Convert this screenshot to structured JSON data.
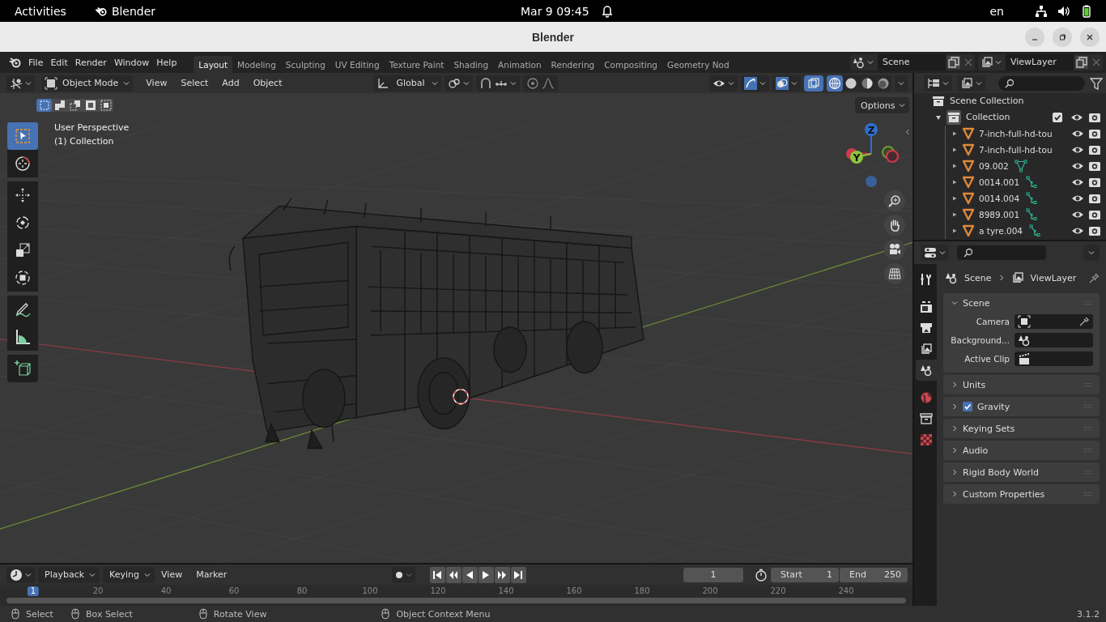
{
  "system_bar": {
    "activities": "Activities",
    "app": "Blender",
    "clock": "Mar 9  09:45",
    "language": "en"
  },
  "window": {
    "title": "Blender"
  },
  "menu": [
    "File",
    "Edit",
    "Render",
    "Window",
    "Help"
  ],
  "workspaces": [
    {
      "label": "Layout",
      "selected": true
    },
    {
      "label": "Modeling",
      "selected": false
    },
    {
      "label": "Sculpting",
      "selected": false
    },
    {
      "label": "UV Editing",
      "selected": false
    },
    {
      "label": "Texture Paint",
      "selected": false
    },
    {
      "label": "Shading",
      "selected": false
    },
    {
      "label": "Animation",
      "selected": false
    },
    {
      "label": "Rendering",
      "selected": false
    },
    {
      "label": "Compositing",
      "selected": false
    },
    {
      "label": "Geometry Nod",
      "selected": false
    }
  ],
  "scene": "Scene",
  "view_layer": "ViewLayer",
  "viewport": {
    "mode": "Object Mode",
    "menus": [
      "View",
      "Select",
      "Add",
      "Object"
    ],
    "orientation": "Global",
    "options": "Options",
    "overlay_lines": [
      "User Perspective",
      "(1) Collection"
    ],
    "select_modes": [
      {
        "kind": "new",
        "selected": true
      },
      {
        "kind": "extend",
        "selected": false
      },
      {
        "kind": "subtract",
        "selected": false
      },
      {
        "kind": "invert",
        "selected": false
      },
      {
        "kind": "intersect",
        "selected": false
      }
    ],
    "tools": [
      {
        "kind": "select",
        "selected": true
      },
      {
        "kind": "cursor",
        "selected": false
      },
      {
        "kind": "move",
        "selected": false
      },
      {
        "kind": "rotate",
        "selected": false
      },
      {
        "kind": "scale",
        "selected": false
      },
      {
        "kind": "transform",
        "selected": false
      },
      {
        "kind": "annotate",
        "selected": false
      },
      {
        "kind": "measure",
        "selected": false
      },
      {
        "kind": "add-cube",
        "selected": false
      }
    ],
    "shading": [
      {
        "kind": "wireframe",
        "selected": true
      },
      {
        "kind": "solid",
        "selected": false
      },
      {
        "kind": "material",
        "selected": false
      },
      {
        "kind": "rendered",
        "selected": false
      }
    ],
    "gizmo": {
      "z": "Z",
      "y": "Y"
    }
  },
  "timeline": {
    "menus": [
      "Playback",
      "Keying",
      "View",
      "Marker"
    ],
    "current_frame": "1",
    "start_label": "Start",
    "start": "1",
    "end_label": "End",
    "end": "250",
    "ruler": [
      {
        "label": "1",
        "selected": true
      },
      {
        "label": "20",
        "selected": false
      },
      {
        "label": "40",
        "selected": false
      },
      {
        "label": "60",
        "selected": false
      },
      {
        "label": "80",
        "selected": false
      },
      {
        "label": "100",
        "selected": false
      },
      {
        "label": "120",
        "selected": false
      },
      {
        "label": "140",
        "selected": false
      },
      {
        "label": "160",
        "selected": false
      },
      {
        "label": "180",
        "selected": false
      },
      {
        "label": "200",
        "selected": false
      },
      {
        "label": "220",
        "selected": false
      },
      {
        "label": "240",
        "selected": false
      }
    ]
  },
  "outliner": {
    "root": "Scene Collection",
    "collection": {
      "name": "Collection",
      "checked": true,
      "expanded": true,
      "children": [
        {
          "name": "7-inch-full-hd-tou"
        },
        {
          "name": "7-inch-full-hd-tou"
        },
        {
          "name": "09.002",
          "kind": "vertices"
        },
        {
          "name": "0014.001",
          "kind": "hook"
        },
        {
          "name": "0014.004",
          "kind": "hook"
        },
        {
          "name": "8989.001",
          "kind": "hook"
        },
        {
          "name": "a tyre.004",
          "kind": "hook"
        }
      ]
    }
  },
  "properties": {
    "tabs": [
      {
        "kind": "tool",
        "selected": false
      },
      {
        "kind": "render",
        "selected": false
      },
      {
        "kind": "output",
        "selected": false
      },
      {
        "kind": "view-layer",
        "selected": false
      },
      {
        "kind": "scene",
        "selected": true
      },
      {
        "kind": "world",
        "selected": false
      },
      {
        "kind": "collection",
        "selected": false
      },
      {
        "kind": "texture",
        "selected": false
      }
    ],
    "breadcrumb": [
      "Scene",
      "ViewLayer"
    ],
    "panels": [
      {
        "title": "Scene",
        "expanded": true,
        "fields": [
          {
            "label": "Camera",
            "kind": "camera"
          },
          {
            "label": "Background...",
            "kind": "scene"
          },
          {
            "label": "Active Clip",
            "kind": "clip"
          }
        ]
      },
      {
        "title": "Units",
        "expanded": false
      },
      {
        "title": "Gravity",
        "expanded": false,
        "checked": true
      },
      {
        "title": "Keying Sets",
        "expanded": false
      },
      {
        "title": "Audio",
        "expanded": false
      },
      {
        "title": "Rigid Body World",
        "expanded": false
      },
      {
        "title": "Custom Properties",
        "expanded": false
      }
    ]
  },
  "status_bar": {
    "hints": [
      "Select",
      "Box Select",
      "Rotate View",
      "Object Context Menu"
    ],
    "version": "3.1.2"
  }
}
